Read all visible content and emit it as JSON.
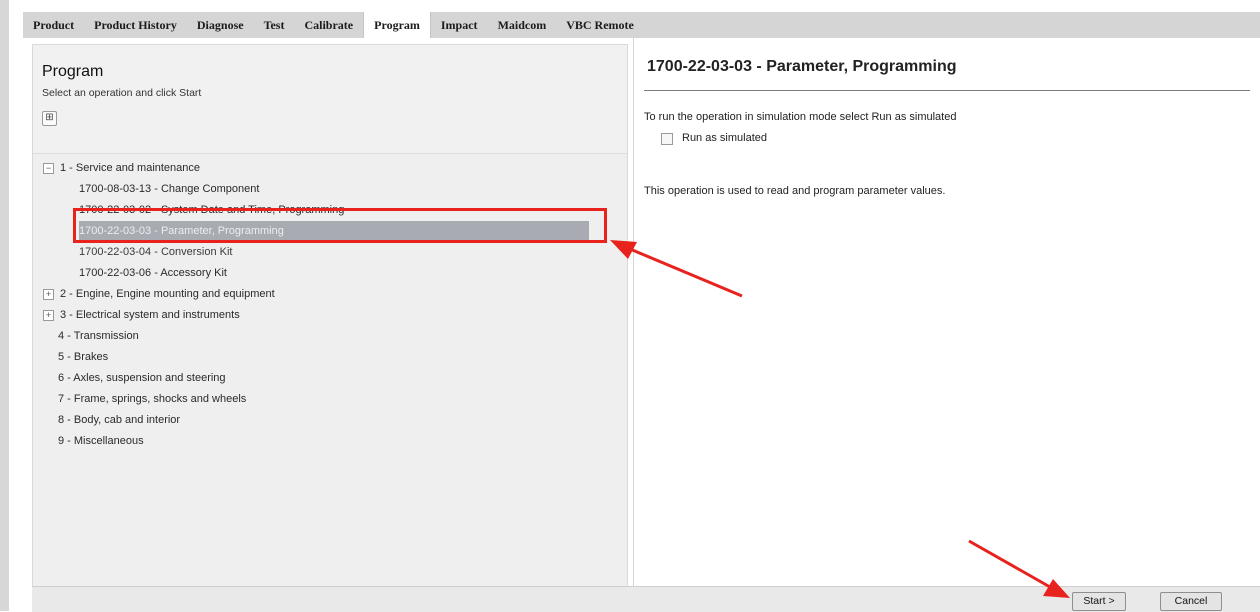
{
  "tabs": [
    "Product",
    "Product History",
    "Diagnose",
    "Test",
    "Calibrate",
    "Program",
    "Impact",
    "Maidcom",
    "VBC Remote"
  ],
  "left": {
    "title": "Program",
    "subtitle": "Select an operation and click Start",
    "expand_symbol": "⊞"
  },
  "tree": {
    "section1": "1 - Service and maintenance",
    "item1": "1700-08-03-13 - Change Component",
    "item2": "1700-22-03-02 - System Date and Time, Programming",
    "item3": "1700-22-03-03 - Parameter, Programming",
    "item4": "1700-22-03-04 - Conversion Kit",
    "item5": "1700-22-03-06 - Accessory Kit",
    "section2": "2 - Engine, Engine mounting and equipment",
    "section3": "3 - Electrical system and instruments",
    "section4": "4 - Transmission",
    "section5": "5 - Brakes",
    "section6": "6 - Axles, suspension and steering",
    "section7": "7 - Frame, springs, shocks and wheels",
    "section8": "8 - Body, cab and interior",
    "section9": "9 - Miscellaneous",
    "collapse_symbol": "−",
    "expand_symbol": "+"
  },
  "right": {
    "title": "1700-22-03-03 - Parameter, Programming",
    "sim_text": "To run the operation in simulation mode select Run as simulated",
    "sim_label": "Run as simulated",
    "description": "This operation is used to read and program parameter values."
  },
  "buttons": {
    "start": "Start >",
    "cancel": "Cancel"
  },
  "colors": {
    "annotation": "#e8231e",
    "selection": "#a8abb2"
  }
}
